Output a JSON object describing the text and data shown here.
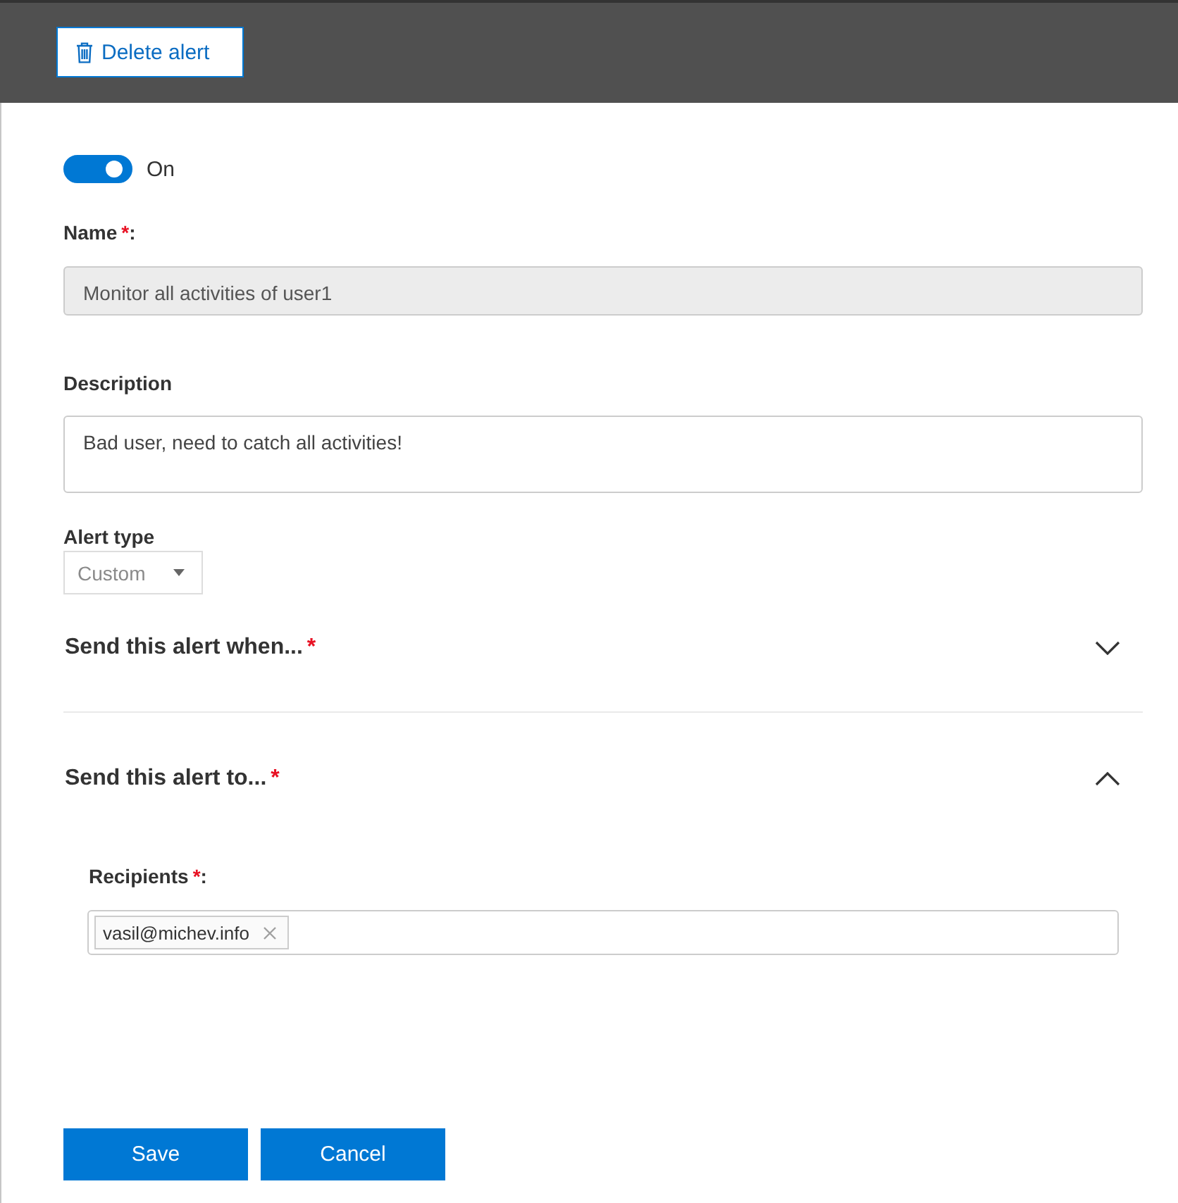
{
  "toolbar": {
    "delete_button": {
      "label": "Delete alert"
    }
  },
  "status_toggle": {
    "on": true,
    "label": "On"
  },
  "name": {
    "label": "Name",
    "required_mark": "*",
    "suffix": ":",
    "value": "Monitor all activities of user1",
    "disabled": true
  },
  "description": {
    "label": "Description",
    "value": "Bad user, need to catch all activities!",
    "disabled": false
  },
  "alert_type": {
    "label": "Alert type",
    "value": "Custom",
    "disabled": true
  },
  "sections": [
    {
      "title": "Send this alert when...",
      "required_mark": "*",
      "expanded": false
    },
    {
      "title": "Send this alert to...",
      "required_mark": "*",
      "expanded": true,
      "recipients": {
        "label": "Recipients",
        "required_mark": "*",
        "suffix": ":",
        "chips": [
          {
            "text": "vasil@michev.info"
          }
        ]
      }
    }
  ],
  "buttons": [
    {
      "label": "Save"
    },
    {
      "label": "Cancel"
    }
  ]
}
